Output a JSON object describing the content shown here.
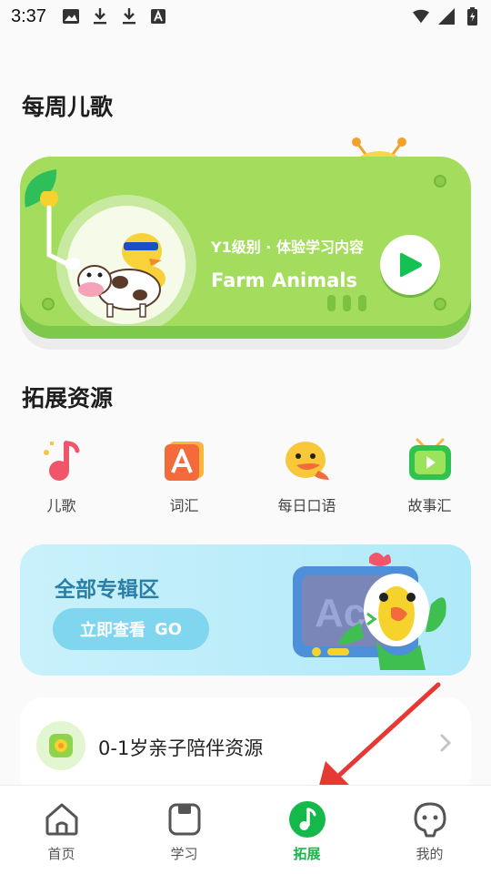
{
  "status_bar": {
    "time": "3:37"
  },
  "weekly_songs": {
    "section_title": "每周儿歌",
    "subtitle": "Y1级别 · 体验学习内容",
    "title": "Farm Animals"
  },
  "resources": {
    "section_title": "拓展资源",
    "items": [
      {
        "label": "儿歌",
        "icon": "music-note-icon"
      },
      {
        "label": "词汇",
        "icon": "vocabulary-card-icon"
      },
      {
        "label": "每日口语",
        "icon": "duck-speaking-icon"
      },
      {
        "label": "故事汇",
        "icon": "tv-play-icon"
      }
    ]
  },
  "album_banner": {
    "title": "全部专辑区",
    "button_label": "立即查看",
    "button_suffix": "GO"
  },
  "list": {
    "item_label": "0-1岁亲子陪伴资源"
  },
  "bottom_nav": {
    "items": [
      {
        "label": "首页"
      },
      {
        "label": "学习"
      },
      {
        "label": "拓展"
      },
      {
        "label": "我的"
      }
    ],
    "active_index": 2
  },
  "colors": {
    "accent_green": "#14b94a",
    "card_green": "#a4dd5d",
    "banner_blue": "#b0e9f9",
    "annotation_red": "#e53935"
  }
}
